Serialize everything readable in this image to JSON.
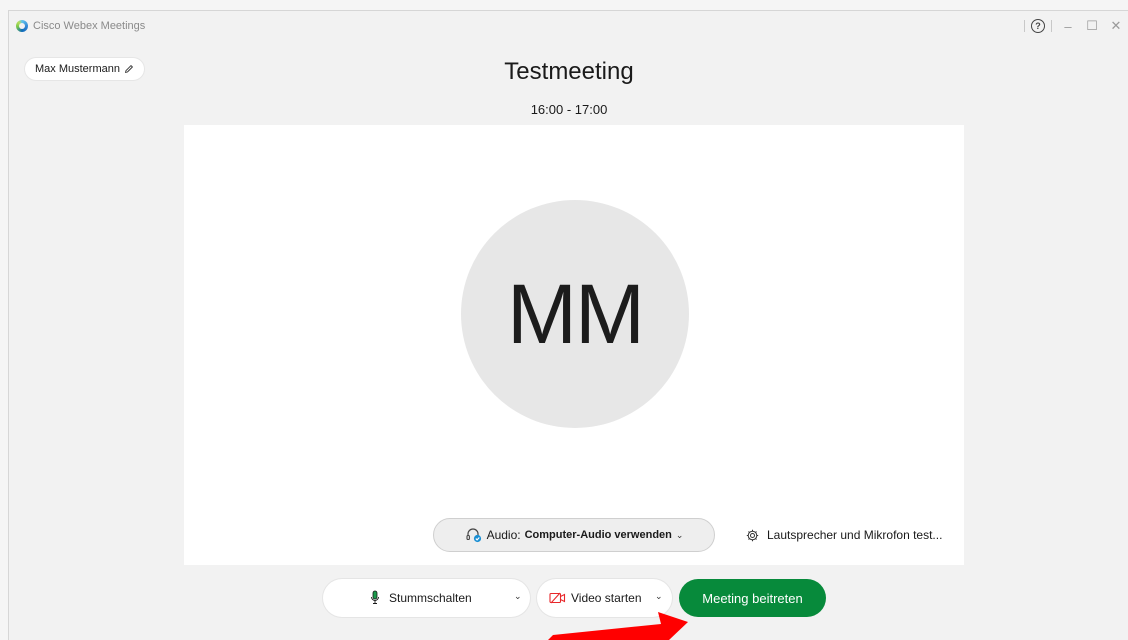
{
  "window": {
    "app_title": "Cisco Webex Meetings",
    "help_icon": "question-circle-icon",
    "minimize_icon": "minimize-icon",
    "maximize_icon": "maximize-icon",
    "close_icon": "close-icon"
  },
  "user": {
    "name": "Max Mustermann",
    "edit_icon": "pencil-icon"
  },
  "meeting": {
    "title": "Testmeeting",
    "time": "16:00 - 17:00"
  },
  "preview": {
    "initials": "MM",
    "audio_prefix": "Audio:",
    "audio_value": "Computer-Audio verwenden",
    "audio_icon": "headset-icon",
    "speaker_test_label": "Lautsprecher und Mikrofon test...",
    "speaker_test_icon": "gear-icon"
  },
  "controls": {
    "mute_label": "Stummschalten",
    "mute_icon": "microphone-icon",
    "video_label": "Video starten",
    "video_icon": "video-off-icon",
    "join_label": "Meeting beitreten"
  },
  "colors": {
    "join_green": "#078a3b",
    "video_red": "#e8282b",
    "mic_green": "#1a9b4b",
    "arrow_red": "#ff0000"
  }
}
